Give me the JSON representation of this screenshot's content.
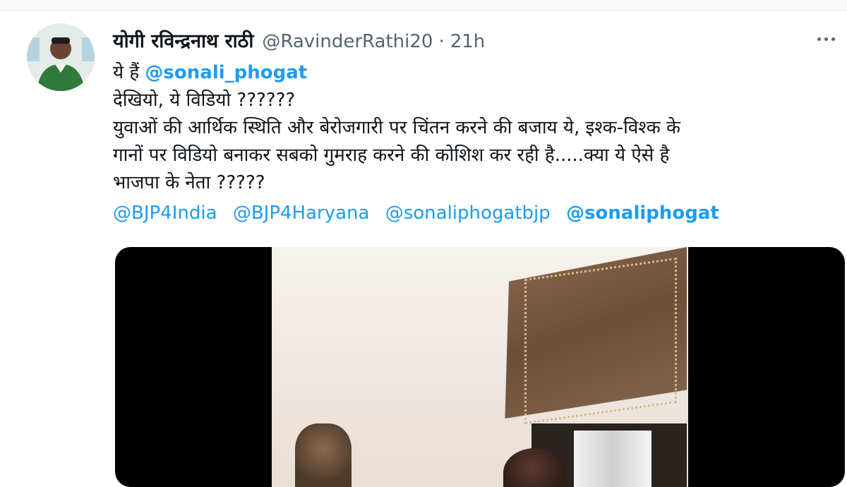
{
  "tweet": {
    "display_name": "योगी रविन्द्रनाथ राठी",
    "handle": "@RavinderRathi20",
    "separator": "·",
    "time": "21h",
    "line1_prefix": "ये हैं ",
    "line1_mention": "@sonali_phogat",
    "line2": "देखियो, ये विडियो ??????",
    "line3": "युवाओं की आर्थिक स्थिति और बेरोजगारी पर चिंतन करने की बजाय ये, इश्क-विश्क के",
    "line4": "गानों पर विडियो बनाकर सबको गुमराह करने की कोशिश कर रही है.....क्या ये ऐसे है",
    "line5": "भाजपा के नेता ?????",
    "tags": [
      "@BJP4India",
      "@BJP4Haryana",
      "@sonaliphogatbjp",
      "@sonaliphogat"
    ]
  },
  "colors": {
    "link": "#1d9bf0",
    "muted": "#536471",
    "text": "#0f1419"
  },
  "icons": {
    "more": "more-horizontal-icon"
  }
}
